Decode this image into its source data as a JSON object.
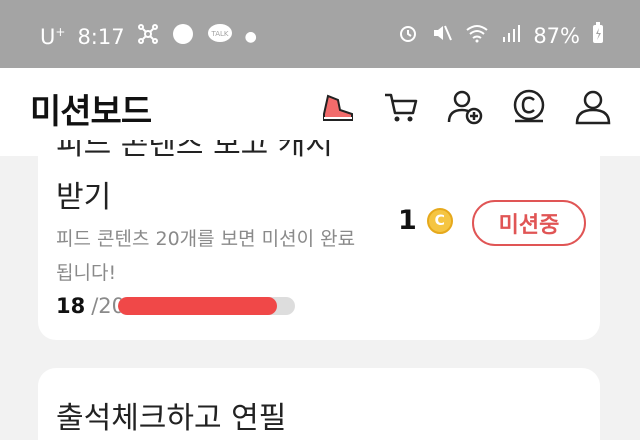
{
  "status_bar": {
    "carrier": "U",
    "carrier_super": "+",
    "time": "8:17",
    "battery": "87%",
    "icons": [
      "network-hub-icon",
      "settings-badge-icon",
      "talk-icon",
      "alarm-icon",
      "mute-icon",
      "wifi-icon",
      "signal-icon",
      "battery-icon"
    ]
  },
  "app_bar": {
    "title": "미션보드",
    "icons": [
      "shoe-icon",
      "cart-icon",
      "add-friend-icon",
      "coin-c-icon",
      "profile-icon"
    ]
  },
  "mission": {
    "clipped_title": "피드 콘텐츠 보고 캐시",
    "title": "받기",
    "description": "피드 콘텐츠 20개를 보면 미션이 완료됩니다!",
    "reward": "1",
    "status_label": "미션중",
    "progress_current": "18",
    "progress_total": "/20",
    "progress_fraction": 0.9
  },
  "mission2": {
    "title": "출석체크하고 연필"
  },
  "colors": {
    "accent": "#e05555",
    "bar": "#f04848",
    "coin": "#f5c542"
  }
}
